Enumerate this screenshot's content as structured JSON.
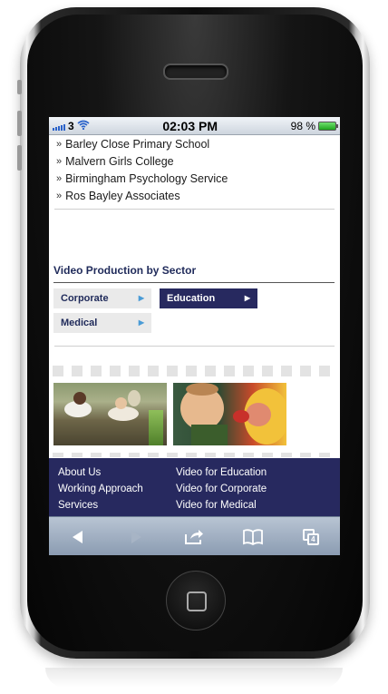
{
  "status_bar": {
    "carrier": "3",
    "time": "02:03 PM",
    "battery": "98 %"
  },
  "clients": [
    "Barley Close Primary School",
    "Malvern Girls College",
    "Birmingham Psychology Service",
    "Ros Bayley Associates"
  ],
  "sector": {
    "title": "Video Production by Sector",
    "buttons": [
      {
        "label": "Corporate",
        "active": false
      },
      {
        "label": "Education",
        "active": true
      },
      {
        "label": "Medical",
        "active": false
      }
    ]
  },
  "footer": {
    "left_links": [
      "About Us",
      "Working Approach",
      "Services"
    ],
    "right_links": [
      "Video for Education",
      "Video for Corporate",
      "Video for Medical"
    ]
  },
  "toolbar": {
    "tab_count": "4",
    "icons": [
      "back-icon",
      "forward-icon",
      "share-icon",
      "bookmarks-icon",
      "tabs-icon"
    ]
  },
  "colors": {
    "navy": "#27295f",
    "light_button": "#eaeaea",
    "arrow_blue": "#4a9bd6"
  }
}
